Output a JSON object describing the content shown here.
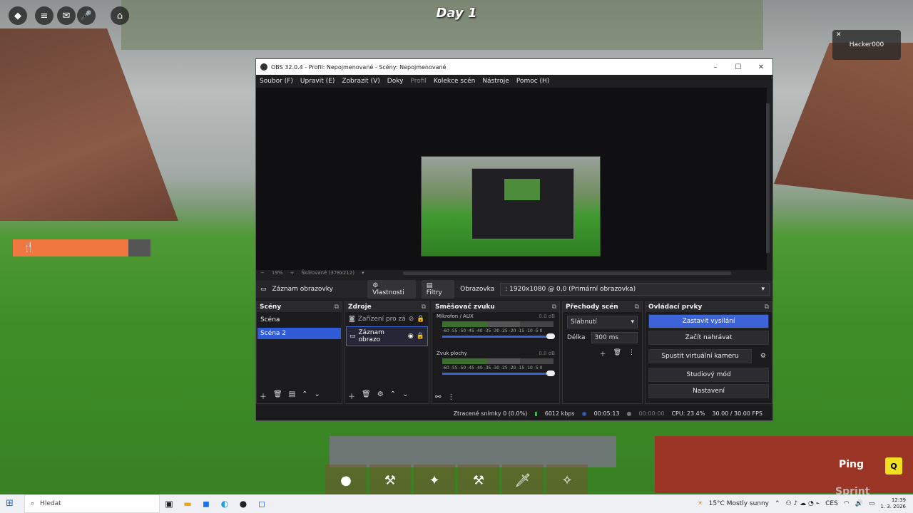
{
  "game": {
    "day_label": "Day 1",
    "notification_name": "Hacker000",
    "ping_label": "Ping",
    "sprint_label": "Sprint",
    "ping_key": "Q",
    "hunger_level": 0.84
  },
  "obs": {
    "title": "OBS 32.0.4 - Profil: Nepojmenované - Scény: Nepojmenované",
    "menu": [
      "Soubor (F)",
      "Upravit (E)",
      "Zobrazit (V)",
      "Doky",
      "Profil",
      "Kolekce scén",
      "Nástroje",
      "Pomoc (H)"
    ],
    "zoom": "19%",
    "scale_label": "Škálované (378x212)",
    "source_bar": {
      "source_name": "Záznam obrazovky",
      "properties_label": "Vlastnosti",
      "filters_label": "Filtry",
      "display_label": "Obrazovka",
      "display_value": ": 1920x1080 @ 0,0 (Primární obrazovka)"
    },
    "scenes": {
      "title": "Scény",
      "items": [
        {
          "label": "Scéna",
          "active": false
        },
        {
          "label": "Scéna 2",
          "active": true
        }
      ]
    },
    "sources": {
      "title": "Zdroje",
      "items": [
        {
          "label": "Zařízení pro zá",
          "active": false
        },
        {
          "label": "Záznam obrazo",
          "active": true
        }
      ]
    },
    "mixer": {
      "title": "Směšovač zvuku",
      "channels": [
        {
          "name": "Mikrofon / AUX",
          "db": "0.0 dB"
        },
        {
          "name": "Zvuk plochy",
          "db": "0.0 dB"
        }
      ],
      "ticks": "-60 -55 -50 -45 -40 -35 -30 -25 -20 -15 -10 -5 0"
    },
    "transitions": {
      "title": "Přechody scén",
      "selected": "Slábnutí",
      "duration_label": "Délka",
      "duration_value": "300 ms"
    },
    "controls": {
      "title": "Ovládací prvky",
      "buttons": [
        "Zastavit vysílání",
        "Začít nahrávat",
        "Spustit virtuální kameru",
        "Studiový mód",
        "Nastavení"
      ]
    },
    "status": {
      "dropped": "Ztracené snímky 0 (0.0%)",
      "bitrate": "6012 kbps",
      "stream_time": "00:05:13",
      "rec_time": "00:00:00",
      "cpu": "CPU: 23.4%",
      "fps": "30.00 / 30.00 FPS"
    }
  },
  "taskbar": {
    "search_placeholder": "Hledat",
    "weather": "15°C  Mostly sunny",
    "lang": "CES",
    "time": "12:39",
    "date": "1. 3. 2026"
  }
}
